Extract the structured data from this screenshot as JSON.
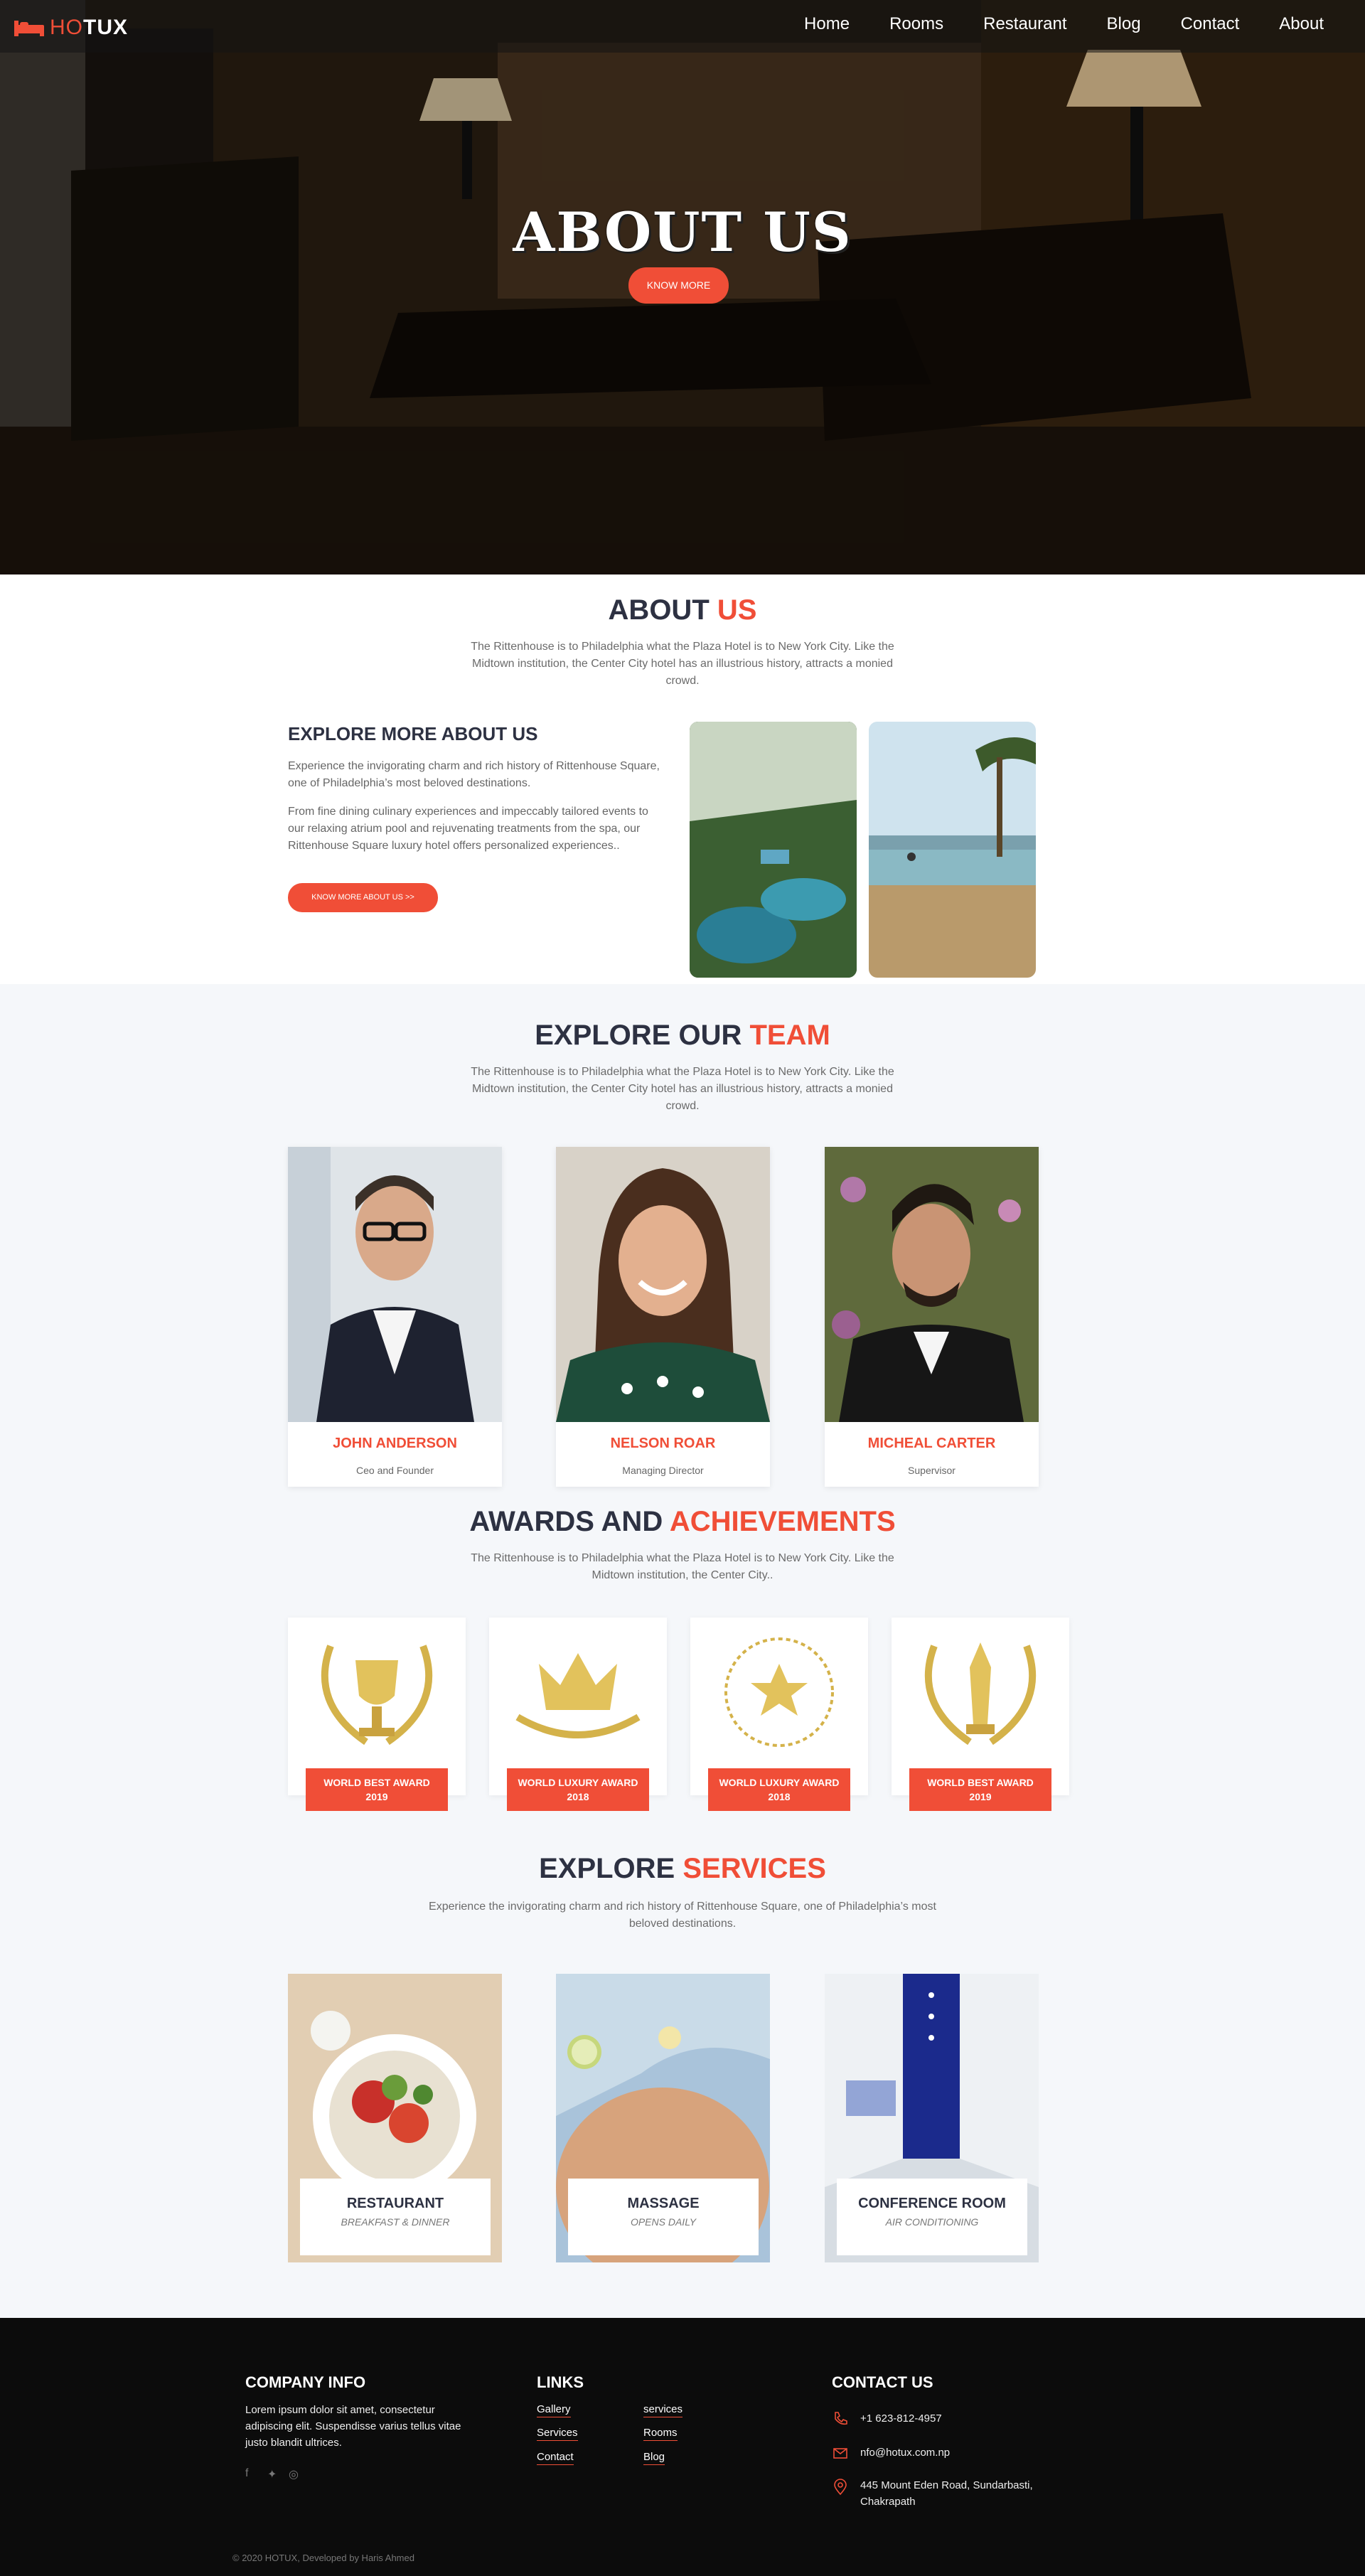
{
  "nav": {
    "logo_prefix": "HO",
    "logo_suffix": "TUX",
    "items": [
      "Home",
      "Rooms",
      "Restaurant",
      "Blog",
      "Contact",
      "About"
    ]
  },
  "hero": {
    "title": "ABOUT US",
    "button": "KNOW MORE"
  },
  "about": {
    "title_main": "ABOUT ",
    "title_accent": "US",
    "desc": "The Rittenhouse is to Philadelphia what the Plaza Hotel is to New York City. Like the Midtown institution, the Center City hotel has an illustrious history, attracts a monied crowd.",
    "explore_title": "EXPLORE MORE ABOUT US",
    "p1": "Experience the invigorating charm and rich history of Rittenhouse Square, one of Philadelphia’s most beloved destinations.",
    "p2": "From fine dining culinary experiences and impeccably tailored events to our relaxing atrium pool and rejuvenating treatments from the spa, our Rittenhouse Square luxury hotel offers personalized experiences..",
    "button": "KNOW MORE ABOUT US >>"
  },
  "team": {
    "title_main": "EXPLORE OUR ",
    "title_accent": "TEAM",
    "desc": "The Rittenhouse is to Philadelphia what the Plaza Hotel is to New York City. Like the Midtown institution, the Center City hotel has an illustrious history, attracts a monied crowd.",
    "members": [
      {
        "name": "JOHN ANDERSON",
        "role": "Ceo and Founder"
      },
      {
        "name": "NELSON ROAR",
        "role": "Managing Director"
      },
      {
        "name": "MICHEAL CARTER",
        "role": "Supervisor"
      }
    ]
  },
  "awards": {
    "title_main": "AWARDS AND ",
    "title_accent": "ACHIEVEMENTS",
    "desc": "The Rittenhouse is to Philadelphia what the Plaza Hotel is to New York City. Like the Midtown institution, the Center City..",
    "items": [
      {
        "line1": "WORLD BEST AWARD",
        "line2": "2019",
        "icon": "trophy-icon"
      },
      {
        "line1": "WORLD LUXURY AWARD",
        "line2": "2018",
        "icon": "crown-icon"
      },
      {
        "line1": "WORLD LUXURY AWARD",
        "line2": "2018",
        "icon": "star-icon"
      },
      {
        "line1": "WORLD BEST AWARD",
        "line2": "2019",
        "icon": "award-icon"
      }
    ]
  },
  "services": {
    "title_main": "EXPLORE ",
    "title_accent": "SERVICES",
    "desc": "Experience the invigorating charm and rich history of Rittenhouse Square, one of Philadelphia’s most beloved destinations.",
    "items": [
      {
        "name": "RESTAURANT",
        "sub": "BREAKFAST & DINNER"
      },
      {
        "name": "MASSAGE",
        "sub": "OPENS DAILY"
      },
      {
        "name": "CONFERENCE ROOM",
        "sub": "AIR CONDITIONING"
      }
    ]
  },
  "footer": {
    "company_title": "COMPANY INFO",
    "company_text": "Lorem ipsum dolor sit amet, consectetur adipiscing elit. Suspendisse varius tellus vitae justo blandit ultrices.",
    "links_title": "LINKS",
    "links_col1": [
      "Gallery",
      "Services",
      "Contact"
    ],
    "links_col2": [
      "services",
      "Rooms",
      "Blog"
    ],
    "contact_title": "CONTACT US",
    "phone": "+1 623-812-4957",
    "email": "nfo@hotux.com.np",
    "address": "445 Mount Eden Road, Sundarbasti, Chakrapath",
    "copyright": "© 2020 HOTUX, Developed by Haris Ahmed"
  },
  "colors": {
    "accent": "#f04e37",
    "dark": "#2d3142",
    "footer": "#0c0c0c"
  }
}
